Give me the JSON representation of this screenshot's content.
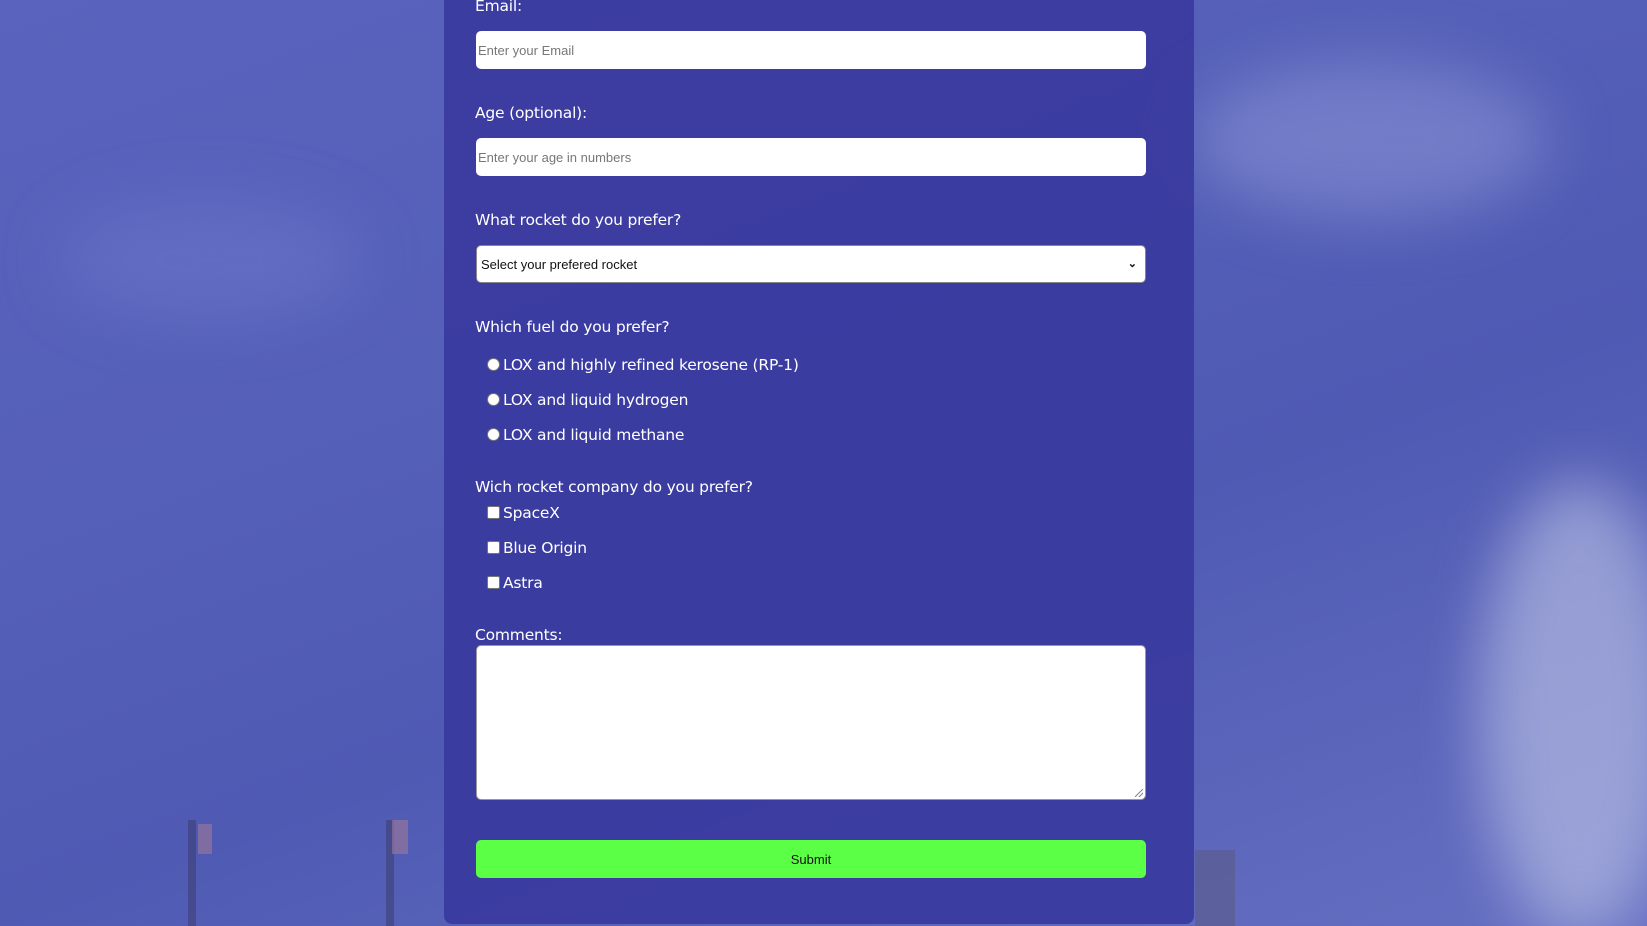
{
  "form": {
    "email_label": "Email:",
    "email_placeholder": "Enter your Email",
    "age_label": "Age (optional):",
    "age_placeholder": "Enter your age in numbers",
    "rocket_label": "What rocket do you prefer?",
    "rocket_selected": "Select your prefered rocket",
    "fuel_label": "Which fuel do you prefer?",
    "fuel_options": [
      {
        "label": "LOX and highly refined kerosene (RP-1)",
        "checked": false
      },
      {
        "label": "LOX and liquid hydrogen",
        "checked": false
      },
      {
        "label": "LOX and liquid methane",
        "checked": false
      }
    ],
    "company_label": "Wich rocket company do you prefer?",
    "company_options": [
      {
        "label": "SpaceX",
        "checked": false
      },
      {
        "label": "Blue Origin",
        "checked": false
      },
      {
        "label": "Astra",
        "checked": false
      }
    ],
    "comments_label": "Comments:",
    "comments_value": "",
    "submit_label": "Submit"
  },
  "colors": {
    "panel": "#3a3a9e",
    "submit": "#5bff45",
    "background": "#5560b8"
  },
  "icons": {
    "select_chevron": "chevron-down-icon"
  }
}
